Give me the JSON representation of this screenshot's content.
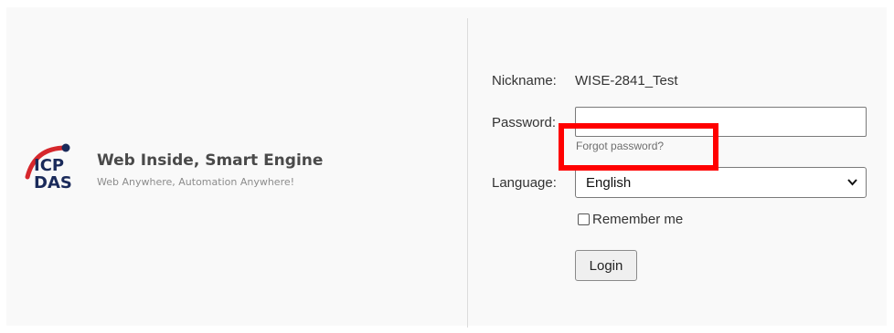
{
  "branding": {
    "logo_text_top": "ICP",
    "logo_text_bottom": "DAS",
    "title": "Web Inside, Smart Engine",
    "subtitle": "Web Anywhere, Automation Anywhere!"
  },
  "login_form": {
    "nickname_label": "Nickname:",
    "nickname_value": "WISE-2841_Test",
    "password_label": "Password:",
    "password_value": "",
    "forgot_password": "Forgot password?",
    "language_label": "Language:",
    "language_selected": "English",
    "remember_me_label": "Remember me",
    "remember_me_checked": false,
    "login_label": "Login"
  },
  "colors": {
    "highlight": "#ff0000",
    "logo_red": "#d6272c",
    "logo_navy": "#1a2a5a"
  },
  "icons": {
    "language_dropdown": "chevron-down-icon"
  }
}
